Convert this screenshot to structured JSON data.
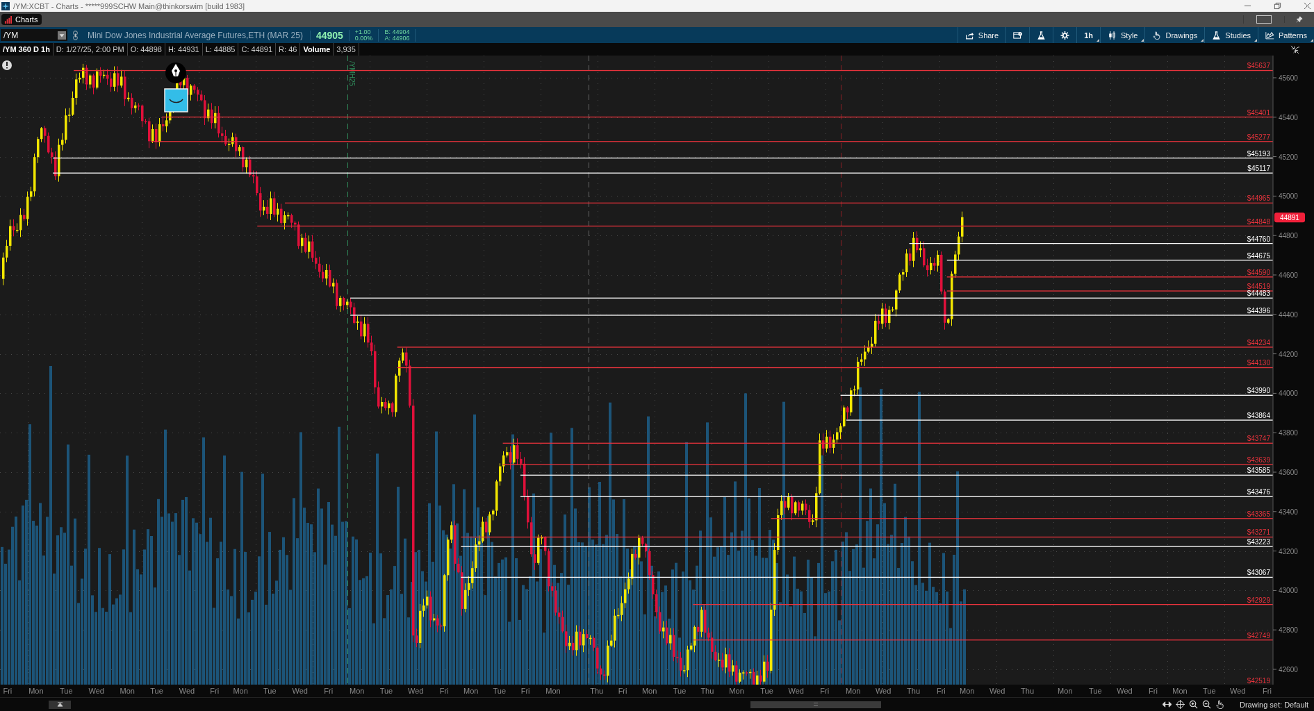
{
  "window": {
    "title": "/YM:XCBT - Charts - *****999SCHW Main@thinkorswim [build 1983]"
  },
  "tabs": [
    {
      "label": "Charts",
      "selected": true
    }
  ],
  "toolbar": {
    "symbol": "/YM",
    "description": "Mini Dow Jones Industrial Average Futures,ETH (MAR 25)",
    "last": "44905",
    "change": "+1.00",
    "change_pct": "0.00%",
    "bid": "B: 44904",
    "ask": "A: 44906",
    "buttons": [
      {
        "kind": "share",
        "label": "Share"
      },
      {
        "kind": "news"
      },
      {
        "kind": "flask"
      },
      {
        "kind": "gear"
      },
      {
        "kind": "text",
        "label": "1h"
      },
      {
        "kind": "style",
        "label": "Style"
      },
      {
        "kind": "drawings",
        "label": "Drawings"
      },
      {
        "kind": "studies",
        "label": "Studies"
      },
      {
        "kind": "patterns",
        "label": "Patterns"
      }
    ]
  },
  "info": [
    {
      "kind": "title",
      "text": "/YM 360 D 1h"
    },
    {
      "kind": "field",
      "text": "D: 1/27/25, 2:00 PM"
    },
    {
      "kind": "field",
      "text": "O: 44898"
    },
    {
      "kind": "field",
      "text": "H: 44931"
    },
    {
      "kind": "field",
      "text": "L: 44885"
    },
    {
      "kind": "field",
      "text": "C: 44891"
    },
    {
      "kind": "field",
      "text": "R: 46"
    },
    {
      "kind": "title",
      "text": "Volume"
    },
    {
      "kind": "field",
      "text": "3,935"
    }
  ],
  "chart": {
    "expiration_marker": "/YMH25",
    "last_price": "44891",
    "y_ticks": [
      "45600",
      "45400",
      "45200",
      "45000",
      "44800",
      "44600",
      "44400",
      "44200",
      "44000",
      "43800",
      "43600",
      "43400",
      "43200",
      "43000",
      "42800",
      "42600"
    ],
    "price_levels": [
      {
        "label": "$45637",
        "color": "#e8333c"
      },
      {
        "label": "$45401",
        "color": "#e8333c"
      },
      {
        "label": "$45277",
        "color": "#e8333c"
      },
      {
        "label": "$45193",
        "color": "#ffffff"
      },
      {
        "label": "$45117",
        "color": "#ffffff"
      },
      {
        "label": "$44965",
        "color": "#e8333c"
      },
      {
        "label": "$44848",
        "color": "#e8333c"
      },
      {
        "label": "$44760",
        "color": "#ffffff"
      },
      {
        "label": "$44675",
        "color": "#ffffff"
      },
      {
        "label": "$44590",
        "color": "#e8333c"
      },
      {
        "label": "$44519",
        "color": "#e8333c"
      },
      {
        "label": "$44483",
        "color": "#ffffff"
      },
      {
        "label": "$44396",
        "color": "#ffffff"
      },
      {
        "label": "$44234",
        "color": "#e8333c"
      },
      {
        "label": "$44130",
        "color": "#e8333c"
      },
      {
        "label": "$43990",
        "color": "#ffffff"
      },
      {
        "label": "$43864",
        "color": "#ffffff"
      },
      {
        "label": "$43747",
        "color": "#e8333c"
      },
      {
        "label": "$43639",
        "color": "#e8333c"
      },
      {
        "label": "$43585",
        "color": "#ffffff"
      },
      {
        "label": "$43476",
        "color": "#ffffff"
      },
      {
        "label": "$43365",
        "color": "#e8333c"
      },
      {
        "label": "$43271",
        "color": "#e8333c"
      },
      {
        "label": "$43223",
        "color": "#ffffff"
      },
      {
        "label": "$43067",
        "color": "#ffffff"
      },
      {
        "label": "$42929",
        "color": "#e8333c"
      },
      {
        "label": "$42749",
        "color": "#e8333c"
      },
      {
        "label": "$42519",
        "color": "#e8333c"
      }
    ],
    "x_labels": [
      "Fri",
      "Mon",
      "Tue",
      "Wed",
      "Mon",
      "Tue",
      "Wed",
      "Fri",
      "Mon",
      "Tue",
      "Wed",
      "Fri",
      "Mon",
      "Tue",
      "Wed",
      "Fri",
      "Mon",
      "Tue",
      "Fri",
      "Mon",
      "Thu",
      "Fri",
      "Mon",
      "Tue",
      "Thu",
      "Mon",
      "Tue",
      "Wed",
      "Fri",
      "Mon",
      "Wed",
      "Thu",
      "Fri",
      "Mon",
      "Wed",
      "Thu",
      "Mon",
      "Tue",
      "Wed",
      "Fri",
      "Mon",
      "Tue",
      "Wed",
      "Fri"
    ]
  },
  "status_bar": {
    "drawing_set": "Drawing set: Default"
  }
}
